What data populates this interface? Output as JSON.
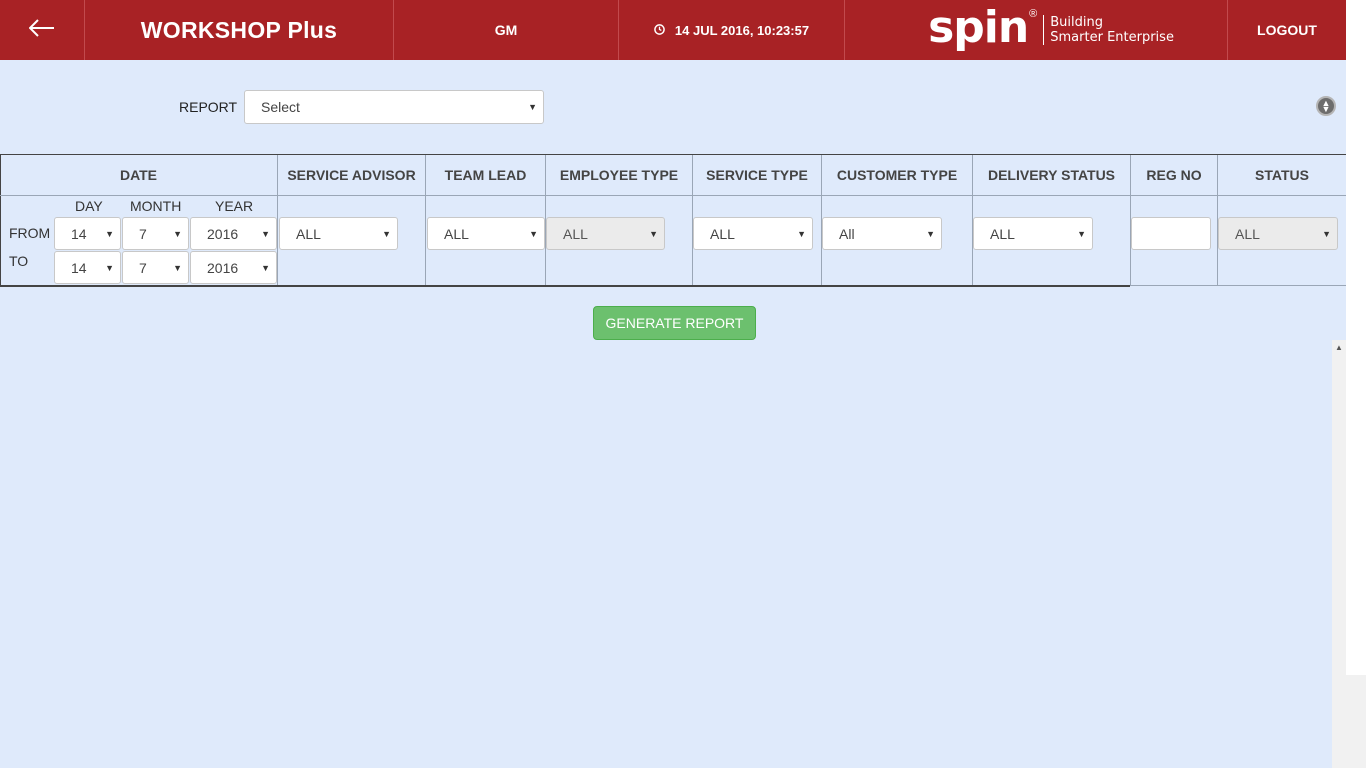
{
  "header": {
    "back_icon": "arrow-left-icon",
    "app_title": "WORKSHOP Plus",
    "user": "GM",
    "clock_icon": "clock-icon",
    "datetime": "14 JUL 2016, 10:23:57",
    "brand_logo": "spin",
    "brand_reg": "®",
    "brand_tagline_1": "Building",
    "brand_tagline_2": "Smarter Enterprise",
    "logout": "LOGOUT",
    "header_color": "#a82225"
  },
  "report": {
    "label": "REPORT",
    "selected": "Select"
  },
  "filters": {
    "date": {
      "header": "DATE",
      "day_label": "DAY",
      "month_label": "MONTH",
      "year_label": "YEAR",
      "from_label": "FROM",
      "to_label": "TO",
      "from": {
        "day": "14",
        "month": "7",
        "year": "2016"
      },
      "to": {
        "day": "14",
        "month": "7",
        "year": "2016"
      }
    },
    "service_advisor": {
      "header": "SERVICE ADVISOR",
      "value": "ALL"
    },
    "team_lead": {
      "header": "TEAM LEAD",
      "value": "ALL"
    },
    "employee_type": {
      "header": "EMPLOYEE TYPE",
      "value": "ALL"
    },
    "service_type": {
      "header": "SERVICE TYPE",
      "value": "ALL"
    },
    "customer_type": {
      "header": "CUSTOMER TYPE",
      "value": "All"
    },
    "delivery_status": {
      "header": "DELIVERY STATUS",
      "value": "ALL"
    },
    "reg_no": {
      "header": "REG NO",
      "value": ""
    },
    "status": {
      "header": "STATUS",
      "value": "ALL"
    }
  },
  "actions": {
    "generate": "GENERATE REPORT",
    "generate_color": "#6cc06e"
  }
}
